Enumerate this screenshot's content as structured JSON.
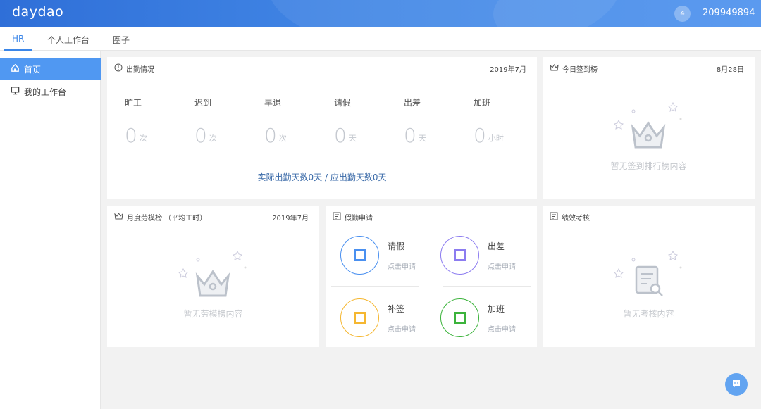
{
  "header": {
    "logo": "daydao",
    "notification_count": "4",
    "username": "209949894"
  },
  "tabs": [
    {
      "label": "HR"
    },
    {
      "label": "个人工作台"
    },
    {
      "label": "圈子"
    }
  ],
  "sidebar": {
    "items": [
      {
        "label": "首页"
      },
      {
        "label": "我的工作台"
      }
    ]
  },
  "attendance": {
    "title": "出勤情况",
    "date": "2019年7月",
    "stats": [
      {
        "label": "旷工",
        "value": "0",
        "unit": "次"
      },
      {
        "label": "迟到",
        "value": "0",
        "unit": "次"
      },
      {
        "label": "早退",
        "value": "0",
        "unit": "次"
      },
      {
        "label": "请假",
        "value": "0",
        "unit": "天"
      },
      {
        "label": "出差",
        "value": "0",
        "unit": "天"
      },
      {
        "label": "加班",
        "value": "0",
        "unit": "小时"
      }
    ],
    "summary": "实际出勤天数0天 / 应出勤天数0天"
  },
  "checkin": {
    "title": "今日签到榜",
    "date": "8月28日",
    "empty": "暂无签到排行榜内容"
  },
  "model_worker": {
    "title": "月度劳模榜 （平均工时）",
    "date": "2019年7月",
    "empty": "暂无劳模榜内容"
  },
  "leave": {
    "title": "假勤申请",
    "items": [
      {
        "name": "请假",
        "sub": "点击申请",
        "color": "#4a90f0"
      },
      {
        "name": "出差",
        "sub": "点击申请",
        "color": "#8c7cf0"
      },
      {
        "name": "补签",
        "sub": "点击申请",
        "color": "#f5b731"
      },
      {
        "name": "加班",
        "sub": "点击申请",
        "color": "#3cb33c"
      }
    ]
  },
  "performance": {
    "title": "绩效考核",
    "empty": "暂无考核内容"
  }
}
